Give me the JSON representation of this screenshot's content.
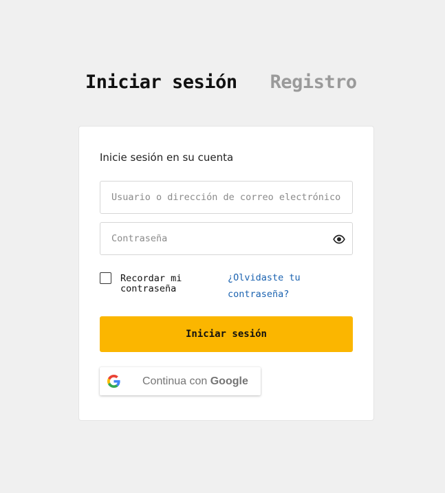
{
  "tabs": {
    "login": "Iniciar sesión",
    "register": "Registro"
  },
  "form": {
    "title": "Inicie sesión en su cuenta",
    "username_placeholder": "Usuario o dirección de correo electrónico",
    "username_value": "",
    "password_placeholder": "Contraseña",
    "password_value": "",
    "remember_label": "Recordar mi contraseña",
    "remember_checked": false,
    "forgot_link": "¿Olvidaste tu contraseña?",
    "submit_label": "Iniciar sesión"
  },
  "google": {
    "label_prefix": "Continua con ",
    "label_brand": "Google",
    "icon": "google-icon"
  },
  "icons": {
    "password_toggle": "eye-icon"
  },
  "colors": {
    "background": "#f0f0f0",
    "card": "#ffffff",
    "accent": "#fbb600",
    "link": "#1a62b0",
    "inactive_tab": "#9a9a9a"
  }
}
